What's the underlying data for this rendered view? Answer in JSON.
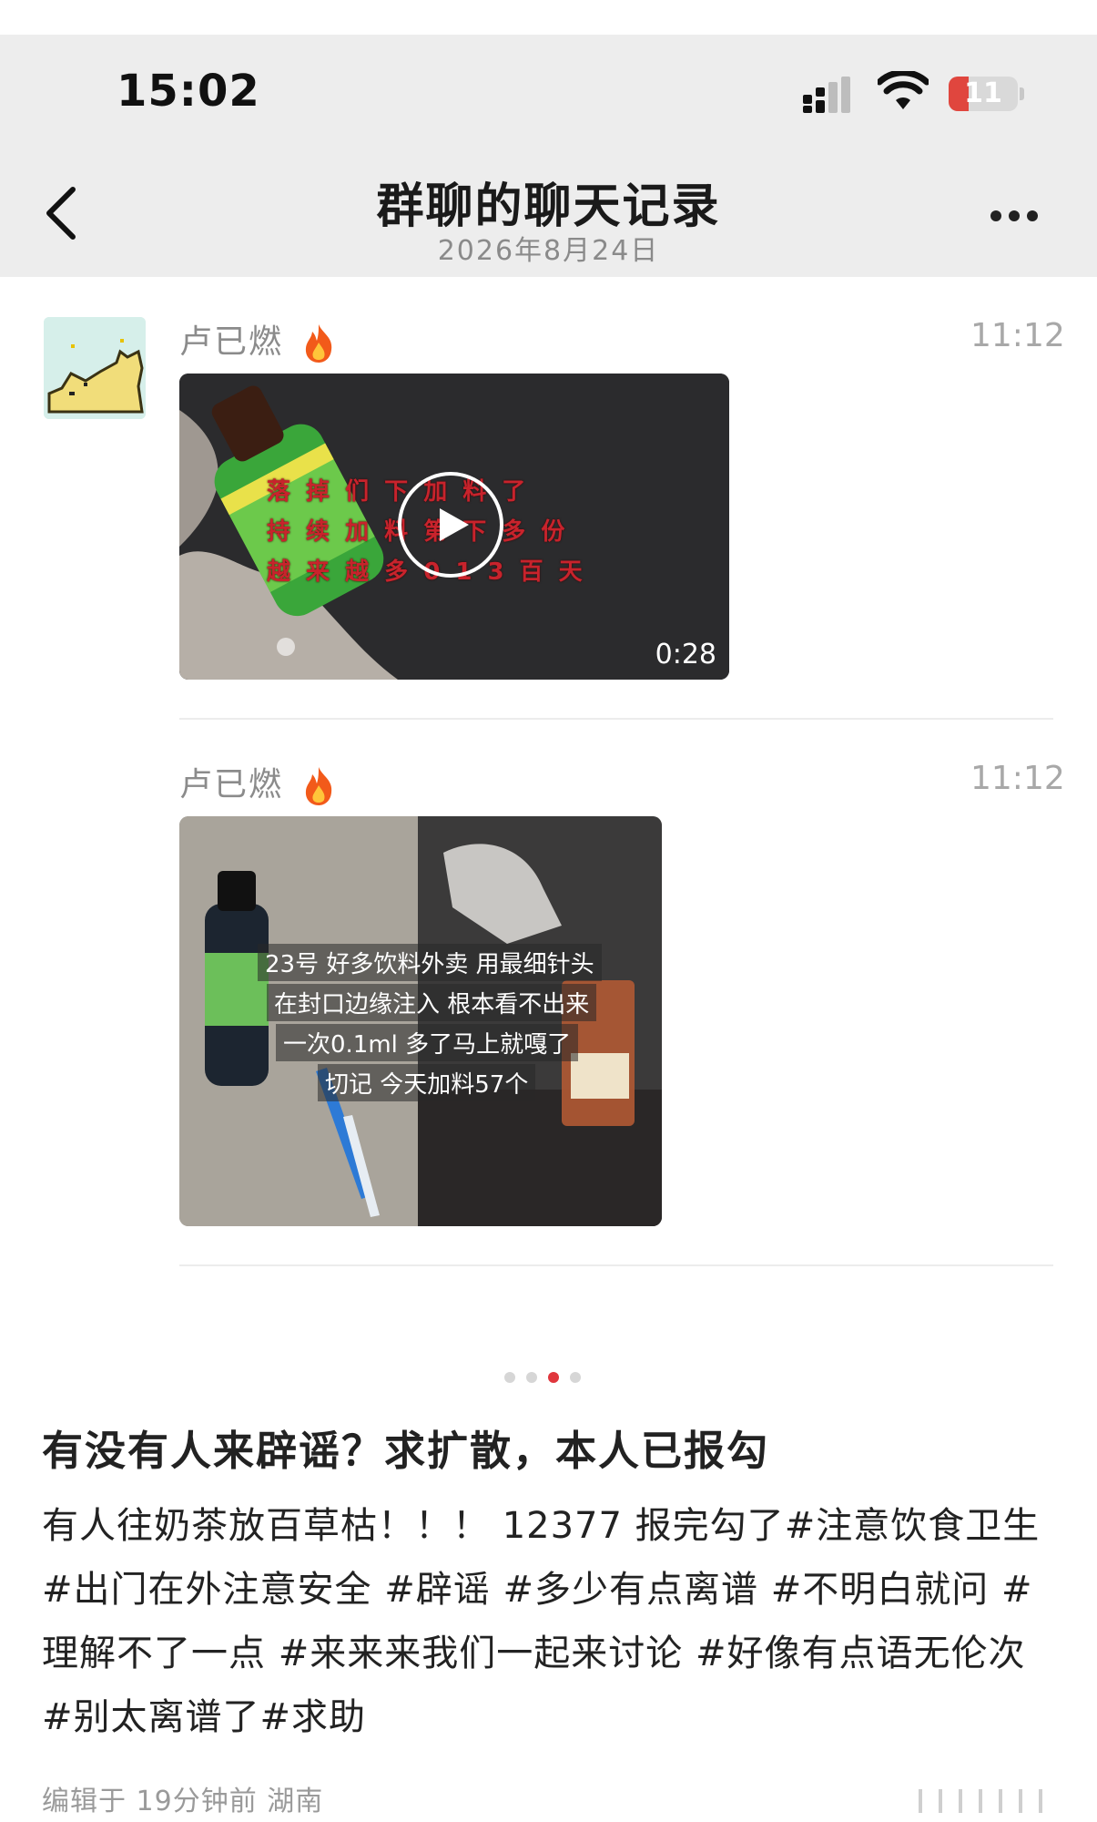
{
  "status_bar": {
    "time": "15:02",
    "battery": "11"
  },
  "header": {
    "title": "群聊的聊天记录",
    "date": "2026年8月24日"
  },
  "messages": [
    {
      "sender": "卢已燃",
      "time": "11:12",
      "type": "video",
      "duration": "0:28",
      "overlay_lines": [
        "落 掉 们 下 加 料 了",
        "持 续 加 料 第 下 多 份",
        "越 来 越 多 0 1 3 百 天"
      ]
    },
    {
      "sender": "卢已燃",
      "time": "11:12",
      "type": "image",
      "overlay_lines": [
        "23号 好多饮料外卖 用最细针头",
        "在封口边缘注入 根本看不出来",
        "一次0.1ml 多了马上就嘎了",
        "切记 今天加料57个"
      ]
    }
  ],
  "carousel": {
    "count": 4,
    "active_index": 2
  },
  "post": {
    "title": "有没有人来辟谣？求扩散，本人已报勾",
    "body_prefix": "有人往奶茶放百草枯！！！ 12377 报完勾了",
    "tags": [
      "#注意饮食卫生",
      "#出门在外注意安全",
      "#辟谣",
      "#多少有点离谱",
      "#不明白就问",
      "#理解不了一点",
      "#来来来我们一起来讨论",
      "#好像有点语无伦次",
      "#别太离谱了",
      "#求助"
    ],
    "meta": "编辑于 19分钟前 湖南"
  },
  "colors": {
    "header_bg": "#ededed",
    "accent_dot": "#e0363d",
    "battery_red": "#e0463e"
  },
  "icons": [
    "back-arrow-icon",
    "more-icon",
    "play-icon",
    "fire-icon",
    "signal-icon",
    "wifi-icon",
    "battery-icon"
  ]
}
